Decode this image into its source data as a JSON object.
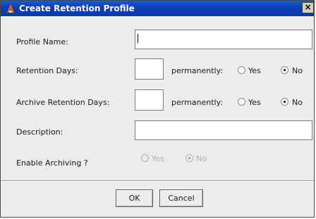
{
  "dialog": {
    "title": "Create Retention Profile",
    "close_label": "×"
  },
  "form": {
    "profile_name_label": "Profile Name:",
    "profile_name_value": "",
    "retention_days_label": "Retention Days:",
    "retention_days_value": "",
    "retention_permanently_label": "permanently:",
    "retention_yes_label": "Yes",
    "retention_no_label": "No",
    "retention_selected": "No",
    "archive_days_label": "Archive Retention Days:",
    "archive_days_value": "",
    "archive_permanently_label": "permanently:",
    "archive_yes_label": "Yes",
    "archive_no_label": "No",
    "archive_selected": "No",
    "description_label": "Description:",
    "description_value": "",
    "enable_archiving_label": "Enable Archiving ?",
    "enable_yes_label": "Yes",
    "enable_no_label": "No",
    "enable_selected": "No"
  },
  "buttons": {
    "ok_label": "OK",
    "cancel_label": "Cancel"
  }
}
